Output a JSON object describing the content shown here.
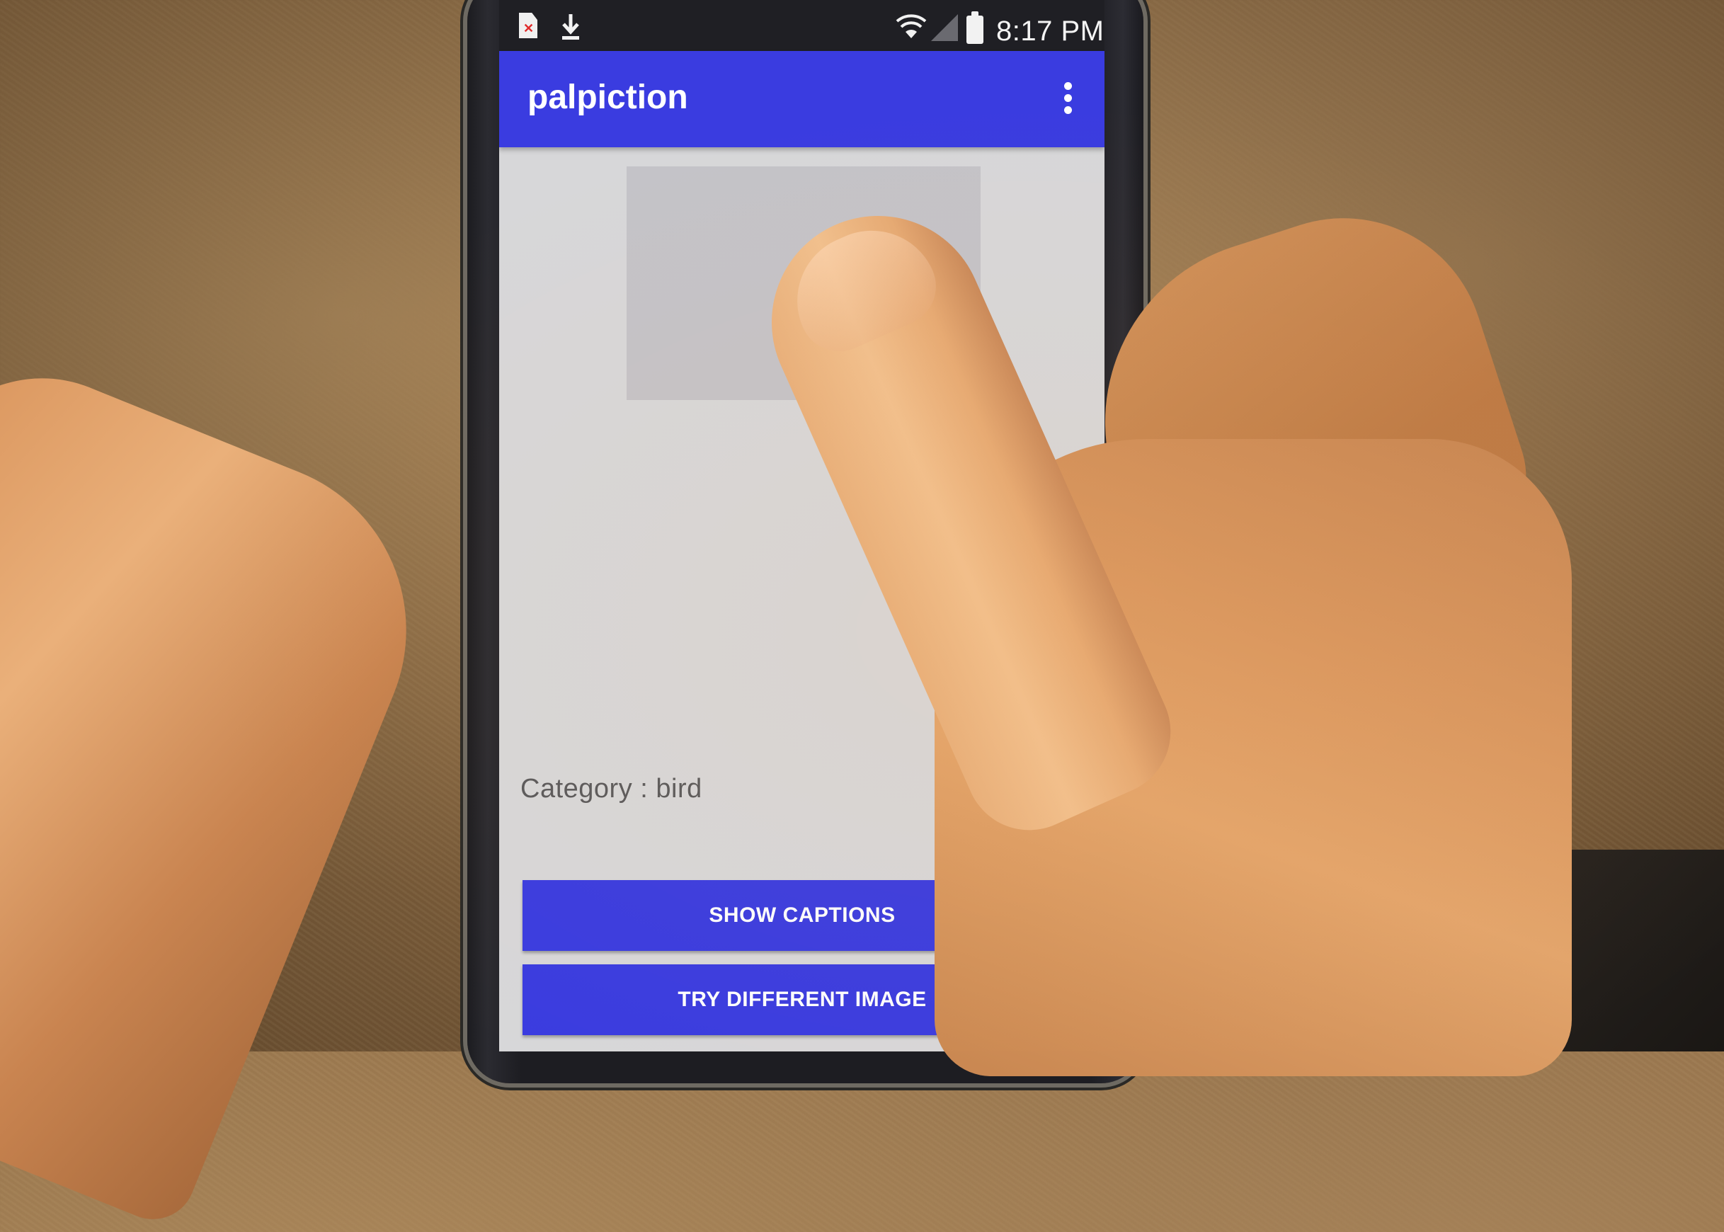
{
  "status_bar": {
    "time": "8:17 PM",
    "icons": [
      "file-error-icon",
      "download-icon",
      "wifi-icon",
      "signal-icon",
      "battery-icon"
    ]
  },
  "app_bar": {
    "title": "palpiction",
    "menu_icon": "overflow-menu-icon"
  },
  "content": {
    "category_text": "Category : bird"
  },
  "buttons": {
    "show_captions": "SHOW CAPTIONS",
    "try_different_image": "TRY DIFFERENT IMAGE"
  },
  "colors": {
    "accent": "#3a3ce0",
    "screen_background": "#d7d7d9",
    "status_bar": "#1f1f24"
  }
}
